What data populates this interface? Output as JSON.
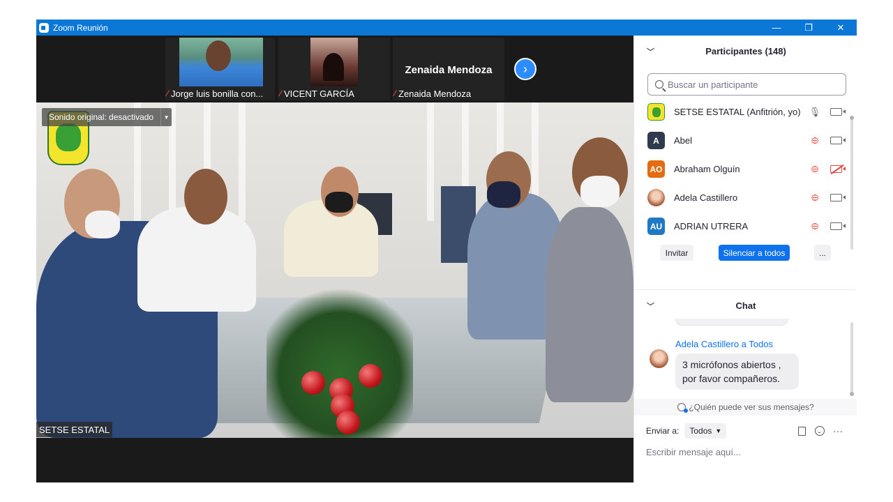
{
  "window": {
    "title": "Zoom Reunión",
    "minimize_glyph": "—",
    "restore_glyph": "❐",
    "close_glyph": "✕"
  },
  "thumbnails": [
    {
      "name": "Jorge luis bonilla con..."
    },
    {
      "name": "VICENT GARCÍA"
    },
    {
      "name": "Zenaida Mendoza",
      "big_name": "Zenaida Mendoza"
    }
  ],
  "main_video": {
    "sound_status": "Sonido original: desactivado",
    "speaker_name": "SETSE ESTATAL"
  },
  "participants": {
    "header": "Participantes (148)",
    "search_placeholder": "Buscar un participante",
    "list": [
      {
        "name": "SETSE ESTATAL (Anfitrión, yo)",
        "initials": "",
        "avatar_color": "#f2e52c",
        "mic_muted": false,
        "camera_off": false
      },
      {
        "name": "Abel",
        "initials": "A",
        "avatar_color": "#2f3a4f",
        "mic_muted": true,
        "camera_off": false
      },
      {
        "name": "Abraham Olguín",
        "initials": "AO",
        "avatar_color": "#e36b12",
        "mic_muted": true,
        "camera_off": true
      },
      {
        "name": "Adela Castillero",
        "initials": "",
        "avatar_color": "#d9a183",
        "mic_muted": true,
        "camera_off": false
      },
      {
        "name": "ADRIAN UTRERA",
        "initials": "AU",
        "avatar_color": "#1f7ac2",
        "mic_muted": true,
        "camera_off": false
      }
    ],
    "buttons": {
      "invite": "Invitar",
      "mute_all": "Silenciar a todos",
      "more": "..."
    }
  },
  "chat": {
    "header": "Chat",
    "messages": [
      {
        "sender": "Adela Castillero a Todos",
        "line1": "3 micrófonos abiertos  ,",
        "line2": "por favor compañeros."
      }
    ],
    "who_can_see": "¿Quién puede ver sus mensajes?",
    "send_to_label": "Enviar a:",
    "send_to_value": "Todos",
    "input_placeholder": "Escribir mensaje aquí...",
    "more_tools": "···"
  },
  "colors": {
    "titlebar": "#0b78d7",
    "accent_blue": "#0e72ed",
    "mute_red": "#e8413c"
  }
}
